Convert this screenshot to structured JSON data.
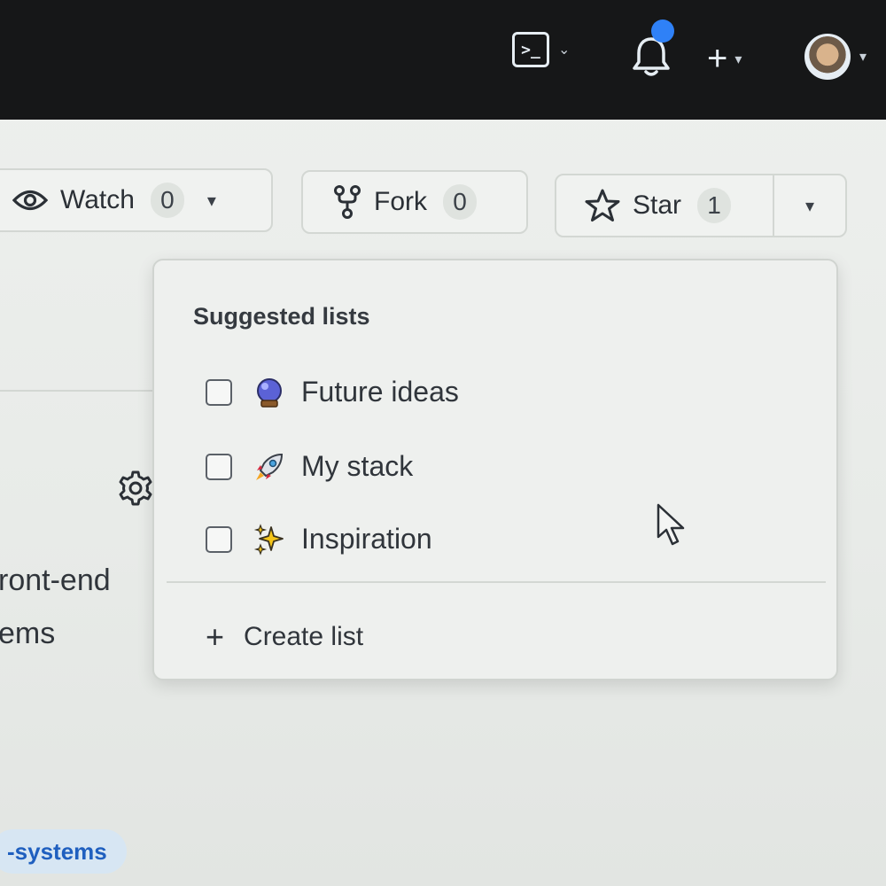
{
  "header": {
    "terminal_glyph": ">_",
    "caret": "⌄",
    "plus": "+",
    "caret_solid": "▾",
    "notification_color": "#2f81f7"
  },
  "repo_actions": {
    "watch_label": "Watch",
    "watch_count": "0",
    "fork_label": "Fork",
    "fork_count": "0",
    "star_label": "Star",
    "star_count": "1",
    "caret": "▾"
  },
  "left_fragments": {
    "line1": "ront-end",
    "line2": "ems",
    "topic": "-systems"
  },
  "lists_menu": {
    "title": "Suggested lists",
    "items": [
      {
        "label": "Future ideas",
        "icon": "crystal-ball-icon",
        "checked": false
      },
      {
        "label": "My stack",
        "icon": "rocket-icon",
        "checked": false
      },
      {
        "label": "Inspiration",
        "icon": "sparkles-icon",
        "checked": false
      }
    ],
    "create_plus": "+",
    "create_label": "Create list"
  }
}
